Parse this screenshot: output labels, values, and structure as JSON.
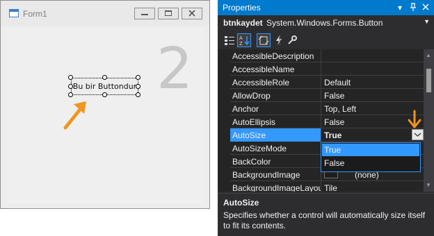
{
  "form": {
    "title": "Form1",
    "button_text": "Bu bir Buttondur",
    "step_number": "2",
    "icons": [
      "form-icon",
      "minimize-icon",
      "maximize-icon",
      "close-icon"
    ]
  },
  "properties": {
    "panel_title": "Properties",
    "object_name": "btnkaydet",
    "object_type": "System.Windows.Forms.Button",
    "toolbar_icons": [
      "categorized-icon",
      "alphabetical-icon",
      "properties-icon",
      "events-icon",
      "property-pages-icon"
    ],
    "rows": [
      {
        "name": "AccessibleDescription",
        "value": ""
      },
      {
        "name": "AccessibleName",
        "value": ""
      },
      {
        "name": "AccessibleRole",
        "value": "Default"
      },
      {
        "name": "AllowDrop",
        "value": "False"
      },
      {
        "name": "Anchor",
        "value": "Top, Left"
      },
      {
        "name": "AutoEllipsis",
        "value": "False"
      },
      {
        "name": "AutoSize",
        "value": "True"
      },
      {
        "name": "AutoSizeMode",
        "value": ""
      },
      {
        "name": "BackColor",
        "value": ""
      },
      {
        "name": "BackgroundImage",
        "value": "(none)"
      },
      {
        "name": "BackgroundImageLayout",
        "value": "Tile"
      }
    ],
    "selected_property": "AutoSize",
    "dropdown_options": [
      "True",
      "False"
    ],
    "highlighted_option": "True",
    "description_title": "AutoSize",
    "description_text": "Specifies whether a control will automatically size itself to fit its contents."
  },
  "colors": {
    "accent": "#007acc",
    "selection": "#3399ff",
    "annotation_arrow": "#f0961e",
    "panel_bg": "#2d2d30"
  }
}
